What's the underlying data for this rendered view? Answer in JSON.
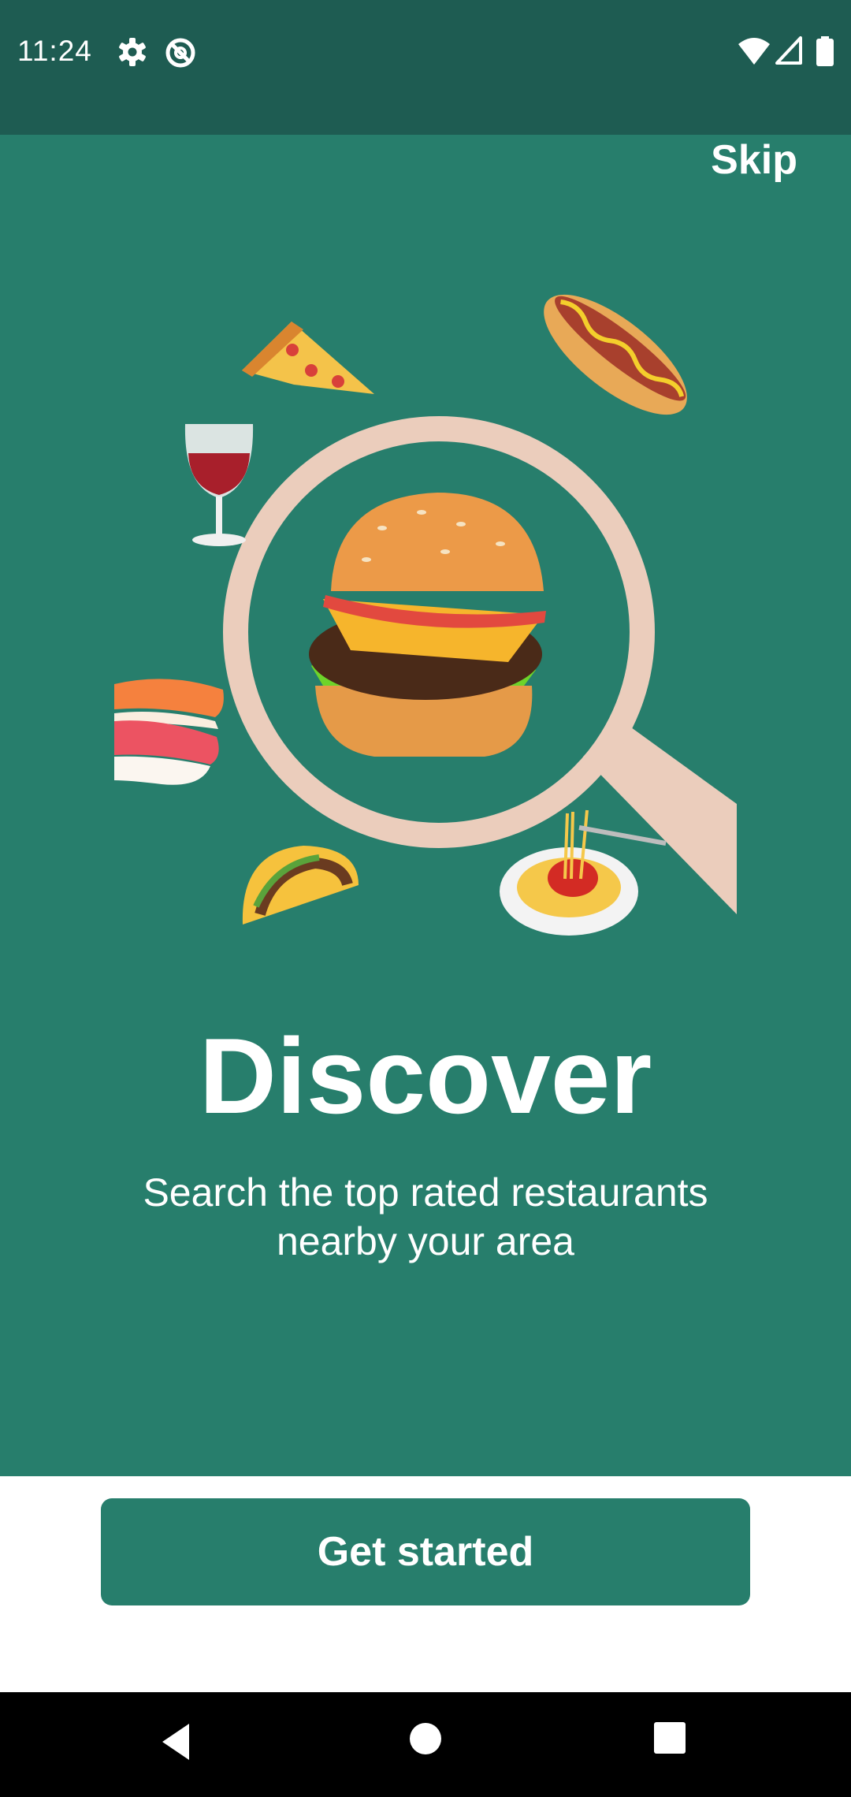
{
  "status_bar": {
    "time": "11:24",
    "icons": [
      "settings-icon",
      "do-not-disturb-icon",
      "wifi-icon",
      "signal-icon",
      "battery-icon"
    ]
  },
  "onboarding": {
    "skip_label": "Skip",
    "title": "Discover",
    "subtitle": "Search the top rated restaurants nearby your area",
    "illustration_icons": [
      "magnifier-icon",
      "burger-icon",
      "pizza-icon",
      "hotdog-icon",
      "wine-icon",
      "sushi-icon",
      "taco-icon",
      "spaghetti-icon"
    ],
    "cta_label": "Get started"
  },
  "navigation": {
    "icons": [
      "back-icon",
      "home-icon",
      "recents-icon"
    ]
  },
  "colors": {
    "primary": "#277e6c",
    "status_bar": "#1e5c52",
    "background": "#ffffff",
    "nav_bar": "#000000"
  }
}
